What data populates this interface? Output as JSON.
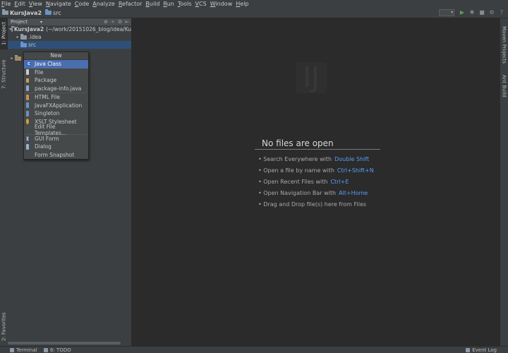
{
  "menu": [
    "File",
    "Edit",
    "View",
    "Navigate",
    "Code",
    "Analyze",
    "Refactor",
    "Build",
    "Run",
    "Tools",
    "VCS",
    "Window",
    "Help"
  ],
  "breadcrumb": [
    {
      "label": "KursJava2",
      "bold": true
    },
    {
      "label": "src",
      "bold": false
    }
  ],
  "run_tools": {
    "run_icon": "▶",
    "debug_icon": "✱",
    "stop_icon": "■",
    "settings_icon": "⚙",
    "help_icon": "?"
  },
  "left_tabs": [
    "1: Project",
    "7: Structure",
    "2: Favorites"
  ],
  "right_tabs": [
    "Maven Projects",
    "Ant Build"
  ],
  "project_panel": {
    "header_label": "Project",
    "header_dropdown": "▾",
    "header_tools": [
      "⊕",
      "÷",
      "⚙",
      "⇤"
    ],
    "tree": [
      {
        "arrow": "▾",
        "label": "KursJava2",
        "path": "(~/work/20151026_blog/idea/Ku",
        "bold": true
      },
      {
        "arrow": "▸",
        "label": ".idea"
      },
      {
        "arrow": "",
        "label": "src"
      },
      {
        "arrow": "▸",
        "label": ""
      }
    ]
  },
  "new_menu": {
    "title": "New",
    "items": [
      {
        "label": "Java Class",
        "icon": "class-icon",
        "highlight": true
      },
      {
        "label": "File",
        "icon": "file-icon"
      },
      {
        "label": "Package",
        "icon": "package-icon"
      },
      {
        "label": "package-info.java",
        "icon": "java-file-icon"
      },
      {
        "label": "HTML File",
        "icon": "html-icon"
      },
      {
        "label": "JavaFXApplication",
        "icon": "javafx-icon"
      },
      {
        "label": "Singleton",
        "icon": "singleton-icon"
      },
      {
        "label": "XSLT Stylesheet",
        "icon": "xslt-icon"
      },
      {
        "label": "Edit File Templates...",
        "icon": "none"
      },
      {
        "label": "GUI Form",
        "icon": "gui-form-icon"
      },
      {
        "label": "Dialog",
        "icon": "dialog-icon"
      },
      {
        "label": "Form Snapshot",
        "icon": "none"
      }
    ]
  },
  "editor": {
    "empty_title": "No files are open",
    "hints": [
      {
        "text": "• Search Everywhere with",
        "shortcut": "Double Shift"
      },
      {
        "text": "• Open a file by name with",
        "shortcut": "Ctrl+Shift+N"
      },
      {
        "text": "• Open Recent Files with",
        "shortcut": "Ctrl+E"
      },
      {
        "text": "• Open Navigation Bar with",
        "shortcut": "Alt+Home"
      },
      {
        "text": "• Drag and Drop file(s) here from Files",
        "shortcut": ""
      }
    ]
  },
  "statusbar": {
    "terminal": "Terminal",
    "todo": "6: TODO",
    "event_log": "Event Log"
  }
}
